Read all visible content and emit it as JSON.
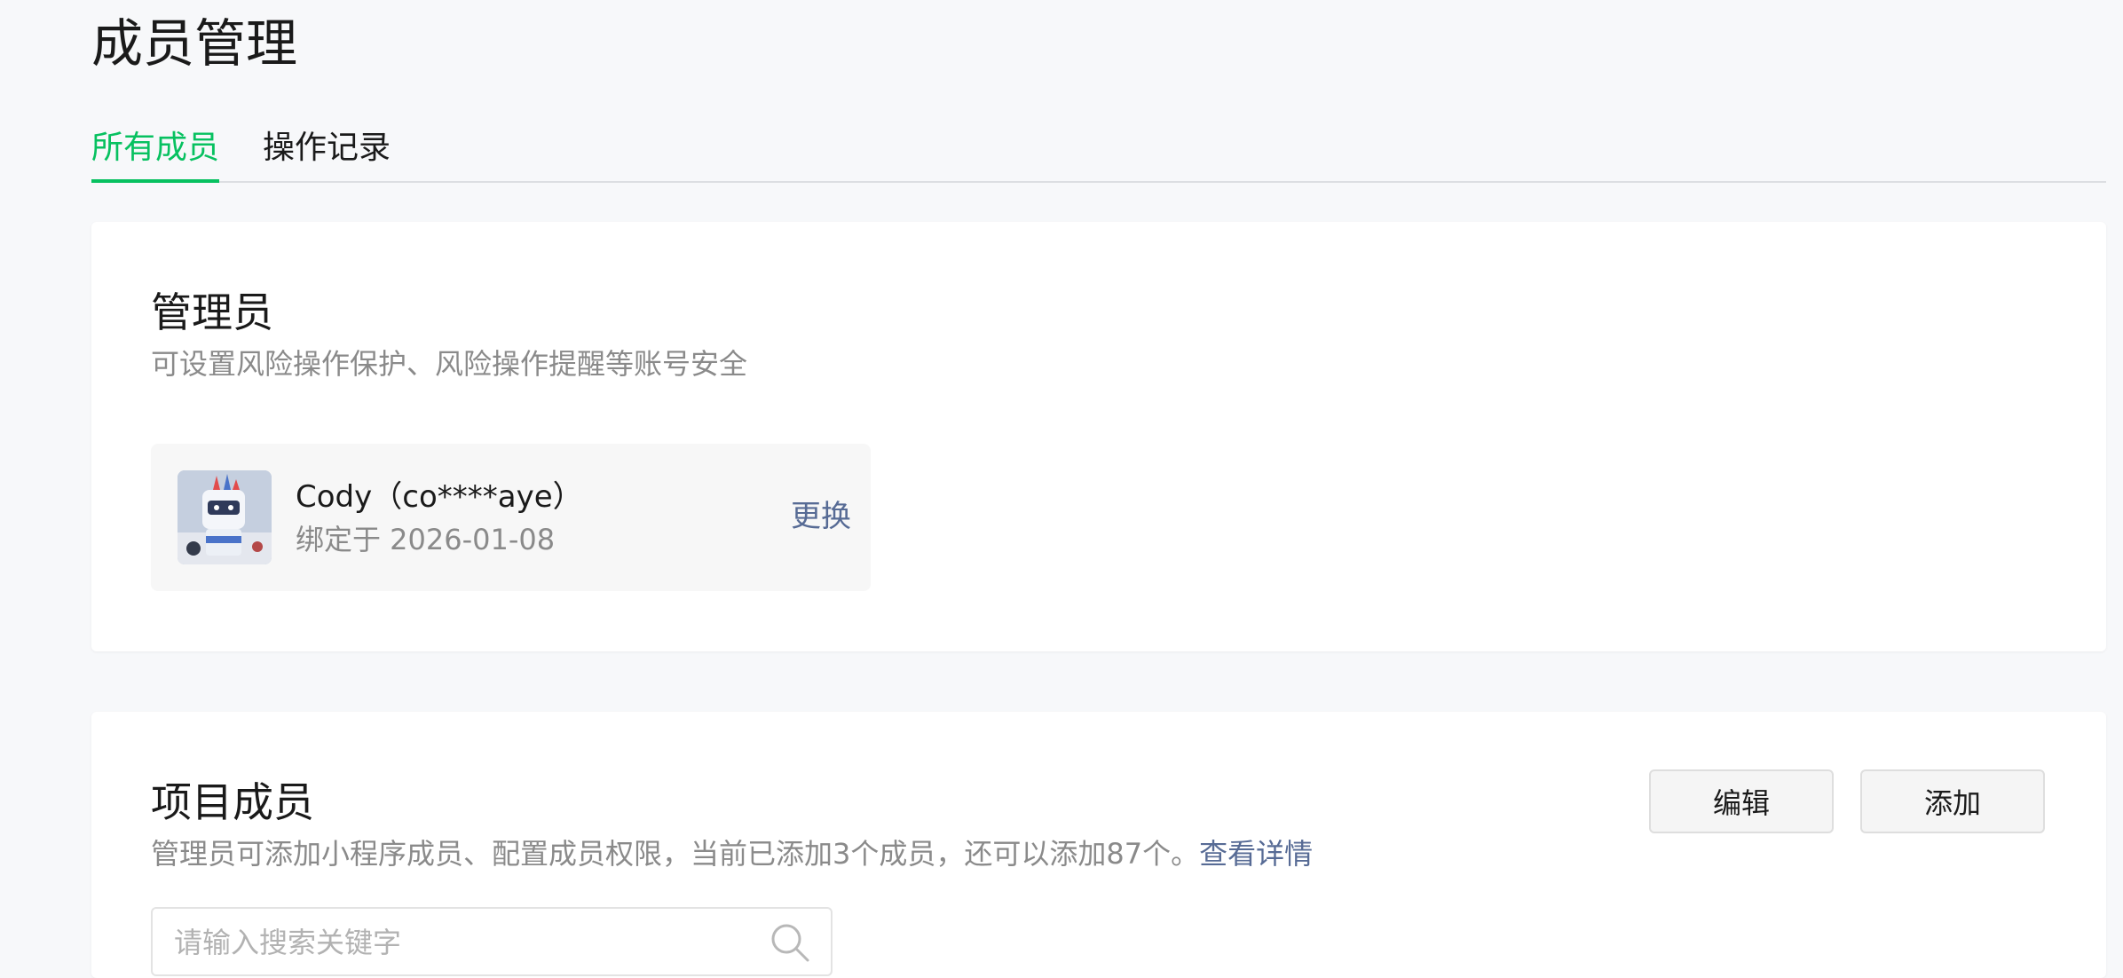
{
  "page": {
    "title": "成员管理"
  },
  "tabs": [
    {
      "label": "所有成员",
      "active": true
    },
    {
      "label": "操作记录",
      "active": false
    }
  ],
  "admin_section": {
    "title": "管理员",
    "description": "可设置风险操作保护、风险操作提醒等账号安全",
    "admin": {
      "name": "Cody（co****aye）",
      "bound_text": "绑定于 2026-01-08",
      "change_label": "更换"
    }
  },
  "members_section": {
    "title": "项目成员",
    "description": "管理员可添加小程序成员、配置成员权限，当前已添加3个成员，还可以添加87个。",
    "detail_link": "查看详情",
    "edit_label": "编辑",
    "add_label": "添加",
    "search": {
      "placeholder": "请输入搜索关键字",
      "value": ""
    }
  },
  "colors": {
    "accent": "#07c160",
    "link": "#576b95",
    "muted": "#8a8a8a"
  },
  "icons": {
    "search": "search-icon",
    "avatar": "avatar-image"
  }
}
